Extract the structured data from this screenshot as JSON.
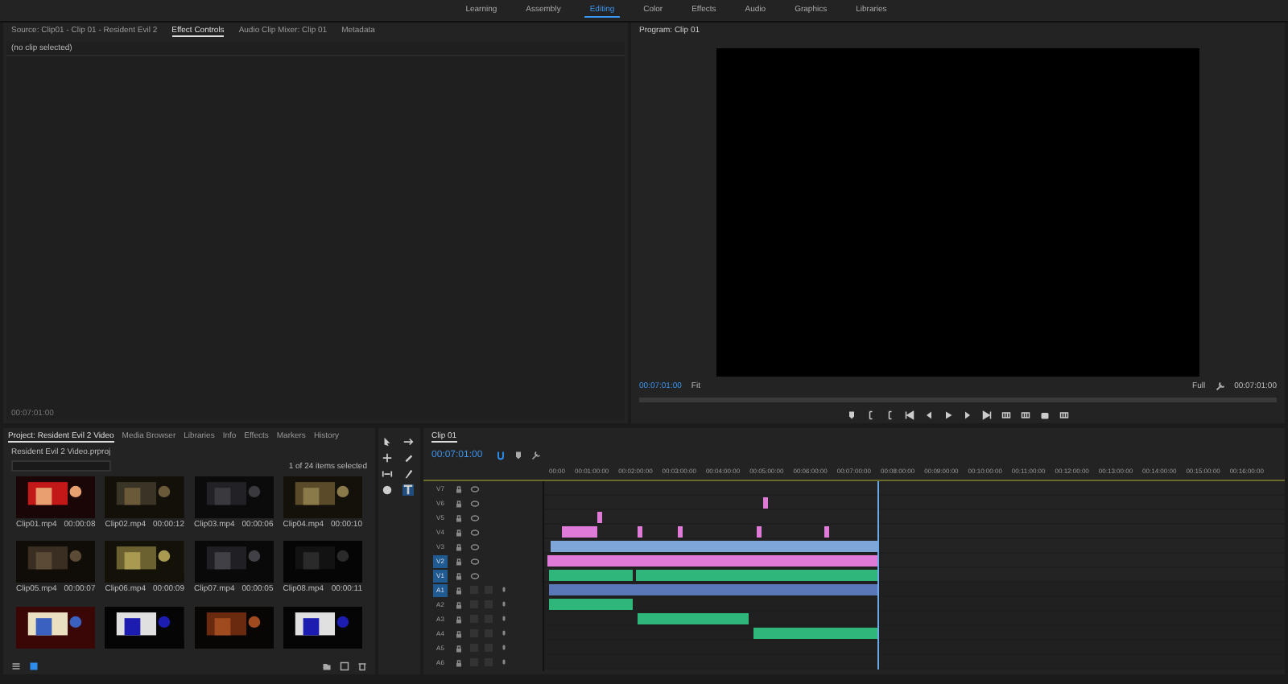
{
  "workspaces": [
    {
      "label": "Learning",
      "selected": false
    },
    {
      "label": "Assembly",
      "selected": false
    },
    {
      "label": "Editing",
      "selected": true
    },
    {
      "label": "Color",
      "selected": false
    },
    {
      "label": "Effects",
      "selected": false
    },
    {
      "label": "Audio",
      "selected": false
    },
    {
      "label": "Graphics",
      "selected": false
    },
    {
      "label": "Libraries",
      "selected": false
    }
  ],
  "source_panel": {
    "tabs": [
      {
        "label": "Source: Clip01 - Clip 01 - Resident Evil 2",
        "selected": false
      },
      {
        "label": "Effect Controls",
        "selected": true
      },
      {
        "label": "Audio Clip Mixer: Clip 01",
        "selected": false
      },
      {
        "label": "Metadata",
        "selected": false
      }
    ],
    "message": "(no clip selected)",
    "timecode": "00:07:01:00"
  },
  "program_monitor": {
    "title": "Program: Clip 01",
    "timecode": "00:07:01:00",
    "zoom": "Fit",
    "resolution": "Full",
    "duration": "00:07:01:00"
  },
  "project_panel": {
    "tabs": [
      {
        "label": "Project: Resident Evil 2 Video",
        "selected": true
      },
      {
        "label": "Media Browser",
        "selected": false
      },
      {
        "label": "Libraries",
        "selected": false
      },
      {
        "label": "Info",
        "selected": false
      },
      {
        "label": "Effects",
        "selected": false
      },
      {
        "label": "Markers",
        "selected": false
      },
      {
        "label": "History",
        "selected": false
      }
    ],
    "path": "Resident Evil 2 Video.prproj",
    "selection": "1 of 24 items selected",
    "items": [
      {
        "name": "Clip01.mp4",
        "duration": "00:00:08"
      },
      {
        "name": "Clip02.mp4",
        "duration": "00:00:12"
      },
      {
        "name": "Clip03.mp4",
        "duration": "00:00:06"
      },
      {
        "name": "Clip04.mp4",
        "duration": "00:00:10"
      },
      {
        "name": "Clip05.mp4",
        "duration": "00:00:07"
      },
      {
        "name": "Clip06.mp4",
        "duration": "00:00:09"
      },
      {
        "name": "Clip07.mp4",
        "duration": "00:00:05"
      },
      {
        "name": "Clip08.mp4",
        "duration": "00:00:11"
      },
      {
        "kind": "picture"
      },
      {
        "kind": "picture"
      },
      {
        "kind": "picture"
      },
      {
        "kind": "picture"
      }
    ]
  },
  "timeline": {
    "title": "Clip 01",
    "timecode": "00:07:01:00",
    "ruler": [
      "00:00",
      "00:01:00:00",
      "00:02:00:00",
      "00:03:00:00",
      "00:04:00:00",
      "00:05:00:00",
      "00:06:00:00",
      "00:07:00:00",
      "00:08:00:00",
      "00:09:00:00",
      "00:10:00:00",
      "00:11:00:00",
      "00:12:00:00",
      "00:13:00:00",
      "00:14:00:00",
      "00:15:00:00",
      "00:16:00:00"
    ],
    "tracks": [
      {
        "name": "V7",
        "kind": "video",
        "targeted": false
      },
      {
        "name": "V6",
        "kind": "video",
        "targeted": false
      },
      {
        "name": "V5",
        "kind": "video",
        "targeted": false
      },
      {
        "name": "V4",
        "kind": "video",
        "targeted": false
      },
      {
        "name": "V3",
        "kind": "video",
        "targeted": false
      },
      {
        "name": "V2",
        "kind": "video",
        "targeted": true
      },
      {
        "name": "V1",
        "kind": "video",
        "targeted": true
      },
      {
        "name": "A1",
        "kind": "audio",
        "targeted": true
      },
      {
        "name": "A2",
        "kind": "audio",
        "targeted": false
      },
      {
        "name": "A3",
        "kind": "audio",
        "targeted": false
      },
      {
        "name": "A4",
        "kind": "audio",
        "targeted": false
      },
      {
        "name": "A5",
        "kind": "audio",
        "targeted": false
      },
      {
        "name": "A6",
        "kind": "audio",
        "targeted": false
      }
    ]
  }
}
